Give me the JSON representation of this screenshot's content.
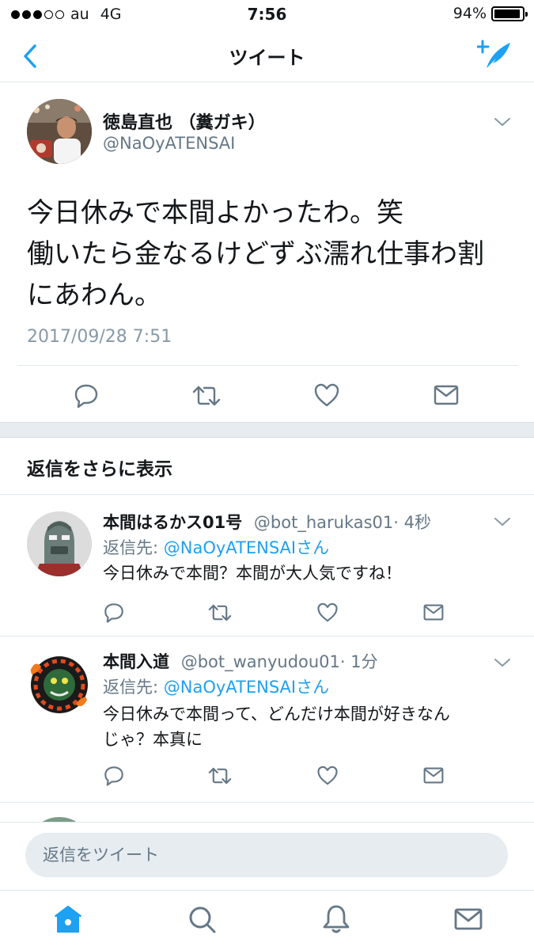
{
  "status_bar": {
    "carrier": "au",
    "network": "4G",
    "time": "7:56",
    "battery_percent": "94%",
    "battery_level": 0.94,
    "signal_bars_filled": 3,
    "signal_bars_total": 5
  },
  "nav": {
    "title": "ツイート",
    "back_icon": "chevron-left-icon",
    "compose_icon": "compose-tweet-icon"
  },
  "main_tweet": {
    "name": "徳島直也 （糞ガキ）",
    "handle": "@NaOyATENSAI",
    "text_lines": [
      "今日休みで本間よかったわ。笑",
      "働いたら金なるけどずぶ濡れ仕事わ割",
      "にあわん。"
    ],
    "timestamp": "2017/09/28 7:51"
  },
  "more_replies": "返信をさらに表示",
  "replies": [
    {
      "name": "本間はるかス01号",
      "handle": "@bot_harukas01",
      "time": "· 4秒",
      "reply_prefix": "返信先: ",
      "reply_to": "@NaOyATENSAIさん",
      "text_lines": [
        "今日休みで本間？本間が大人気ですね！"
      ]
    },
    {
      "name": "本間入道",
      "handle": "@bot_wanyudou01",
      "time": "· 1分",
      "reply_prefix": "返信先: ",
      "reply_to": "@NaOyATENSAIさん",
      "text_lines": [
        "今日休みで本間って、どんだけ本間が好きなん",
        "じゃ？本真に"
      ]
    }
  ],
  "compose": {
    "placeholder": "返信をツイート"
  },
  "colors": {
    "accent": "#1da1f2",
    "text": "#14171a",
    "muted": "#657786",
    "divider": "#e1e8ed"
  }
}
